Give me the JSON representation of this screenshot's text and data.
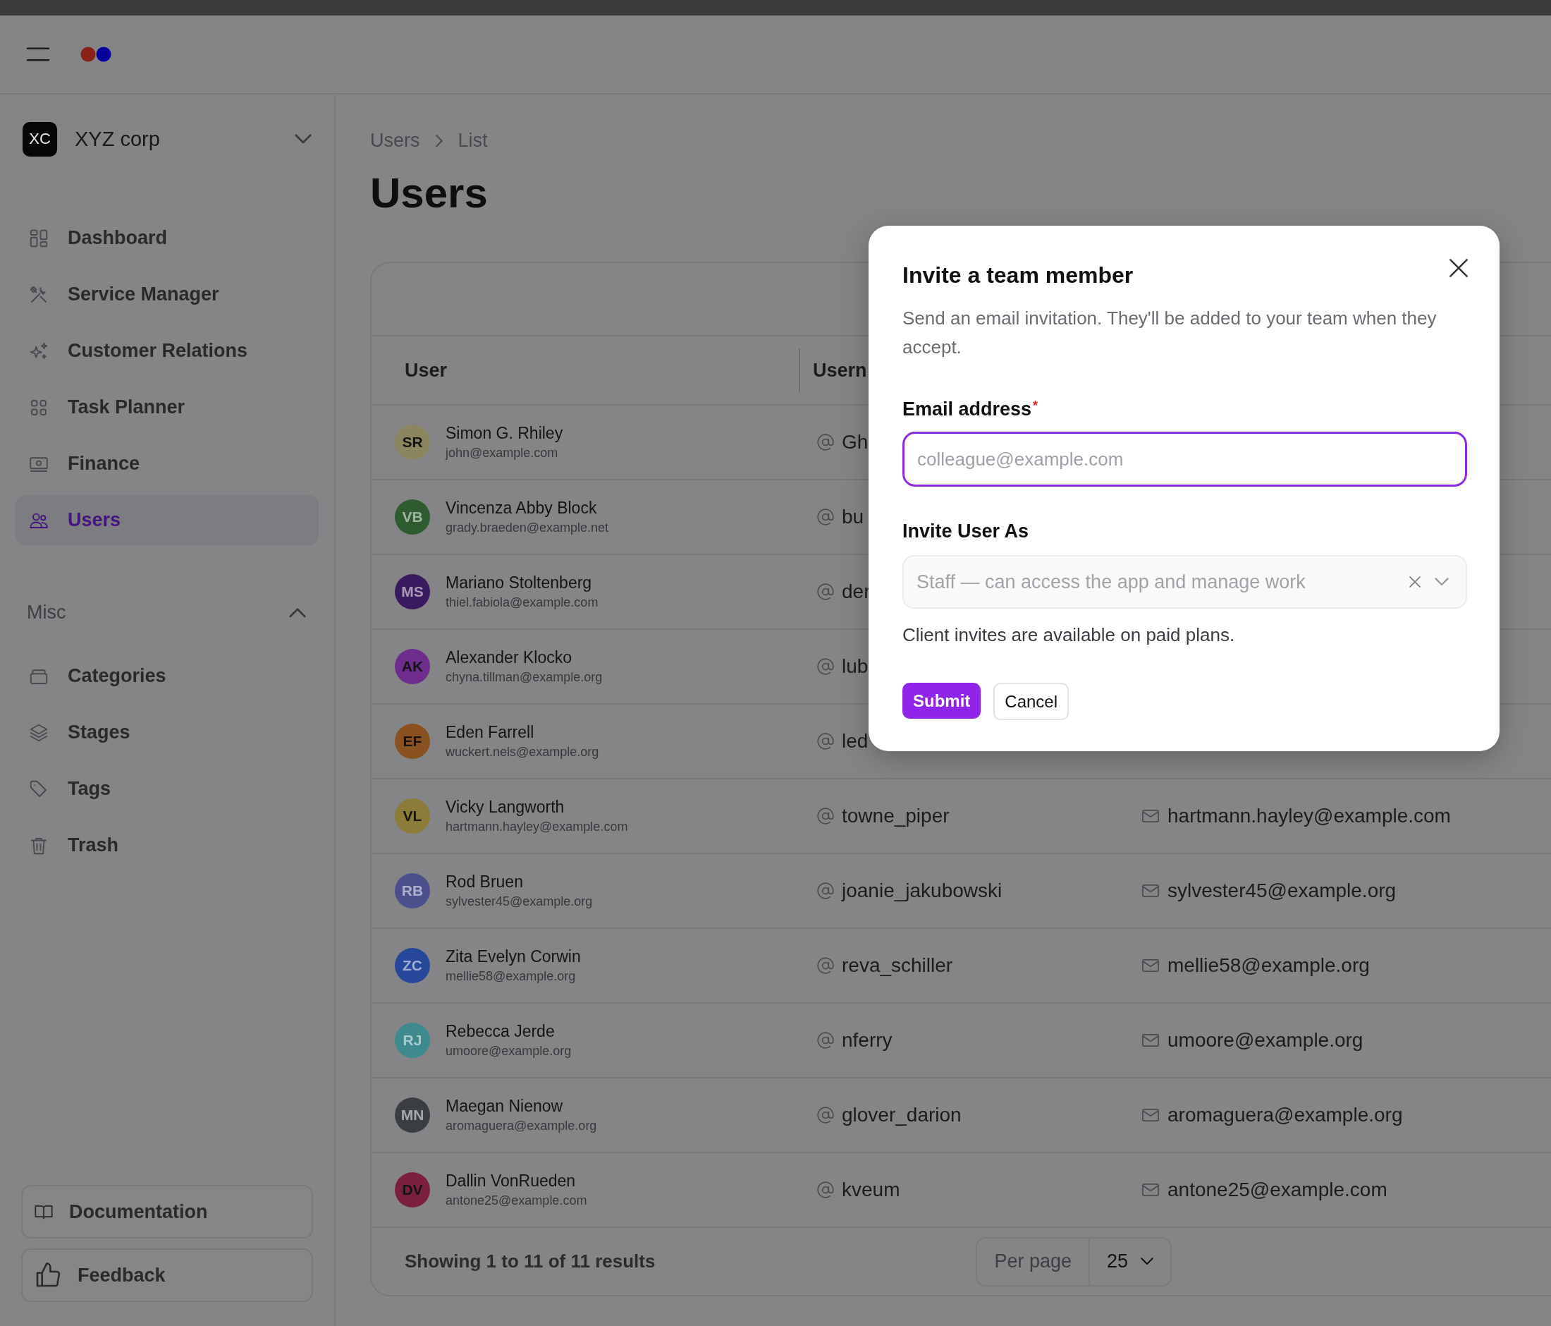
{
  "workspace": {
    "initials": "XC",
    "name": "XYZ corp"
  },
  "nav": [
    {
      "label": "Dashboard",
      "selected": false
    },
    {
      "label": "Service Manager",
      "selected": false
    },
    {
      "label": "Customer Relations",
      "selected": false
    },
    {
      "label": "Task Planner",
      "selected": false
    },
    {
      "label": "Finance",
      "selected": false
    },
    {
      "label": "Users",
      "selected": true
    }
  ],
  "misc": {
    "label": "Misc",
    "expanded": true,
    "items": [
      {
        "label": "Categories",
        "selected": false
      },
      {
        "label": "Stages",
        "selected": false
      },
      {
        "label": "Tags",
        "selected": false
      },
      {
        "label": "Trash",
        "selected": false
      }
    ]
  },
  "sidebar_buttons": [
    "Documentation",
    "Feedback"
  ],
  "breadcrumbs": [
    "Users",
    "List"
  ],
  "title": "Users",
  "table": {
    "columns": [
      "User",
      "Usern"
    ],
    "rows": [
      {
        "initials": "SR",
        "color": "#8b8660",
        "name": "Simon G. Rhiley",
        "email": "john@example.com",
        "username": "Gh"
      },
      {
        "initials": "VB",
        "color": "#2e5c30",
        "name": "Vincenza Abby Block",
        "email": "grady.braeden@example.net",
        "username": "bu"
      },
      {
        "initials": "MS",
        "color": "#3a1a5e",
        "name": "Mariano Stoltenberg",
        "email": "thiel.fabiola@example.com",
        "username": "der"
      },
      {
        "initials": "AK",
        "color": "#6e2d8c",
        "name": "Alexander Klocko",
        "email": "chyna.tillman@example.org",
        "username": "lub"
      },
      {
        "initials": "EF",
        "color": "#8a5220",
        "name": "Eden Farrell",
        "email": "wuckert.nels@example.org",
        "username": "led"
      },
      {
        "initials": "VL",
        "color": "#8c7c3a",
        "name": "Vicky Langworth",
        "email": "hartmann.hayley@example.com",
        "username": "towne_piper",
        "contact": "hartmann.hayley@example.com"
      },
      {
        "initials": "RB",
        "color": "#4b508c",
        "name": "Rod Bruen",
        "email": "sylvester45@example.org",
        "username": "joanie_jakubowski",
        "contact": "sylvester45@example.org"
      },
      {
        "initials": "ZC",
        "color": "#27489a",
        "name": "Zita Evelyn Corwin",
        "email": "mellie58@example.org",
        "username": "reva_schiller",
        "contact": "mellie58@example.org"
      },
      {
        "initials": "RJ",
        "color": "#3f8a8f",
        "name": "Rebecca Jerde",
        "email": "umoore@example.org",
        "username": "nferry",
        "contact": "umoore@example.org"
      },
      {
        "initials": "MN",
        "color": "#3a3d42",
        "name": "Maegan Nienow",
        "email": "aromaguera@example.org",
        "username": "glover_darion",
        "contact": "aromaguera@example.org"
      },
      {
        "initials": "DV",
        "color": "#7a1f3d",
        "name": "Dallin VonRueden",
        "email": "antone25@example.com",
        "username": "kveum",
        "contact": "antone25@example.com"
      }
    ]
  },
  "footer": {
    "summary": "Showing 1 to 11 of 11 results",
    "per_page_label": "Per page",
    "per_page_value": "25"
  },
  "modal": {
    "title": "Invite a team member",
    "description": "Send an email invitation. They'll be added to your team when they accept.",
    "email_label": "Email address",
    "required_mark": "*",
    "email_placeholder": "colleague@example.com",
    "role_label": "Invite User As",
    "role_value": "Staff — can access the app and manage work",
    "helper": "Client invites are available on paid plans.",
    "submit": "Submit",
    "cancel": "Cancel"
  }
}
